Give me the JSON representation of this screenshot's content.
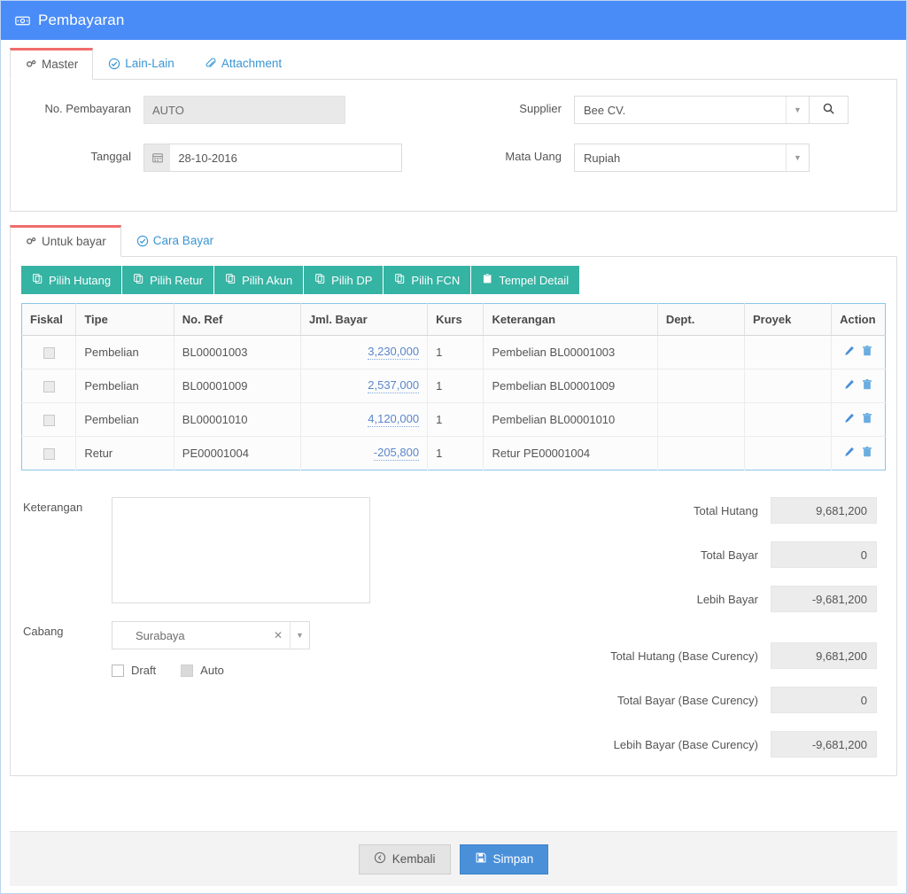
{
  "window": {
    "title": "Pembayaran",
    "title_icon": "money-bill-icon",
    "header_color": "#4a8cf7"
  },
  "main_tabs": [
    {
      "label": "Master",
      "icon": "gears-icon",
      "active": true
    },
    {
      "label": "Lain-Lain",
      "icon": "check-circle-icon",
      "active": false
    },
    {
      "label": "Attachment",
      "icon": "paperclip-icon",
      "active": false
    }
  ],
  "master": {
    "no_pembayaran_label": "No. Pembayaran",
    "no_pembayaran_value": "AUTO",
    "tanggal_label": "Tanggal",
    "tanggal_value": "28-10-2016",
    "tanggal_icon": "calendar-icon",
    "supplier_label": "Supplier",
    "supplier_value": "Bee CV.",
    "supplier_search_icon": "search-icon",
    "mata_uang_label": "Mata Uang",
    "mata_uang_value": "Rupiah"
  },
  "detail_tabs": [
    {
      "label": "Untuk bayar",
      "icon": "gears-icon",
      "active": true
    },
    {
      "label": "Cara Bayar",
      "icon": "check-circle-icon",
      "active": false
    }
  ],
  "toolbar": {
    "color": "#35b3a3",
    "buttons": [
      {
        "label": "Pilih Hutang",
        "icon": "copy-icon"
      },
      {
        "label": "Pilih Retur",
        "icon": "copy-icon"
      },
      {
        "label": "Pilih Akun",
        "icon": "copy-icon"
      },
      {
        "label": "Pilih DP",
        "icon": "copy-icon"
      },
      {
        "label": "Pilih FCN",
        "icon": "copy-icon"
      },
      {
        "label": "Tempel Detail",
        "icon": "paste-icon"
      }
    ]
  },
  "table": {
    "columns": [
      "Fiskal",
      "Tipe",
      "No. Ref",
      "Jml. Bayar",
      "Kurs",
      "Keterangan",
      "Dept.",
      "Proyek",
      "Action"
    ],
    "rows": [
      {
        "fiskal": false,
        "tipe": "Pembelian",
        "no_ref": "BL00001003",
        "jml_bayar": "3,230,000",
        "kurs": "1",
        "keterangan": "Pembelian BL00001003",
        "dept": "",
        "proyek": ""
      },
      {
        "fiskal": false,
        "tipe": "Pembelian",
        "no_ref": "BL00001009",
        "jml_bayar": "2,537,000",
        "kurs": "1",
        "keterangan": "Pembelian BL00001009",
        "dept": "",
        "proyek": ""
      },
      {
        "fiskal": false,
        "tipe": "Pembelian",
        "no_ref": "BL00001010",
        "jml_bayar": "4,120,000",
        "kurs": "1",
        "keterangan": "Pembelian BL00001010",
        "dept": "",
        "proyek": ""
      },
      {
        "fiskal": false,
        "tipe": "Retur",
        "no_ref": "PE00001004",
        "jml_bayar": "-205,800",
        "kurs": "1",
        "keterangan": "Retur PE00001004",
        "dept": "",
        "proyek": ""
      }
    ],
    "row_action_icons": [
      "pencil-icon",
      "trash-icon"
    ]
  },
  "lower": {
    "keterangan_label": "Keterangan",
    "keterangan_value": "",
    "cabang_label": "Cabang",
    "cabang_value": "Surabaya",
    "cabang_clear_icon": "clear-x-icon",
    "draft_label": "Draft",
    "draft_checked": false,
    "auto_label": "Auto",
    "auto_checked": false,
    "auto_disabled": true
  },
  "totals": [
    {
      "label": "Total Hutang",
      "value": "9,681,200"
    },
    {
      "label": "Total Bayar",
      "value": "0"
    },
    {
      "label": "Lebih Bayar",
      "value": "-9,681,200"
    }
  ],
  "totals_base": [
    {
      "label": "Total Hutang (Base Curency)",
      "value": "9,681,200"
    },
    {
      "label": "Total Bayar (Base Curency)",
      "value": "0"
    },
    {
      "label": "Lebih Bayar (Base Curency)",
      "value": "-9,681,200"
    }
  ],
  "footer": {
    "back_label": "Kembali",
    "back_icon": "arrow-circle-left-icon",
    "save_label": "Simpan",
    "save_icon": "floppy-disk-icon",
    "save_color": "#4a90d9"
  }
}
